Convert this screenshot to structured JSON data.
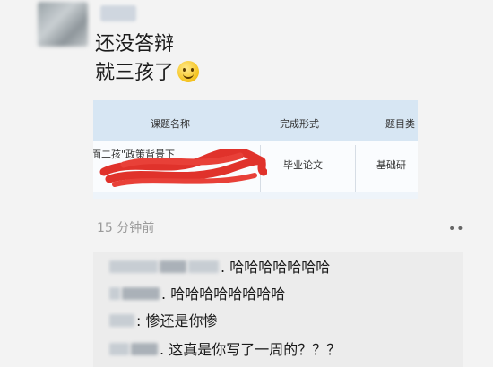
{
  "post": {
    "line1": "还没答辩",
    "line2": "就三孩了"
  },
  "doc": {
    "headers": [
      "课题名称",
      "完成形式",
      "题目类"
    ],
    "row": [
      "面二孩\"政策背景下",
      "毕业论文",
      "基础研"
    ]
  },
  "meta": {
    "time": "15 分钟前",
    "more": "••"
  },
  "comments": [
    {
      "sep": ".",
      "text": "哈哈哈哈哈哈哈"
    },
    {
      "sep": ".",
      "text": "哈哈哈哈哈哈哈哈"
    },
    {
      "sep": ":",
      "text": "惨还是你惨"
    },
    {
      "sep": ".",
      "text": "这真是你写了一周的？？？"
    }
  ],
  "colors": {
    "background": "#f3f3f3",
    "comment_bg": "#ececec",
    "doc_header": "#d7e6f3",
    "redaction": "#e0322b"
  },
  "icons": {
    "smiley": "smiley-emoji-icon",
    "more": "more-dots-icon"
  }
}
